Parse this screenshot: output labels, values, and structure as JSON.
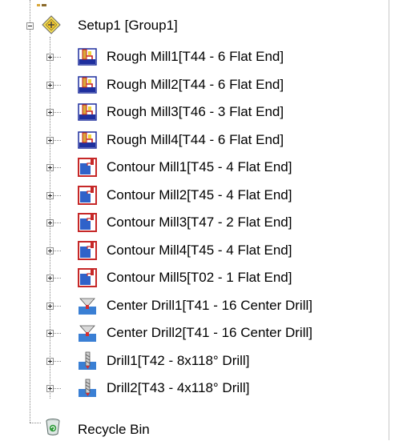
{
  "tree": {
    "setup": {
      "label": "Setup1 [Group1]",
      "expanded": true,
      "icon": "setup-diamond-icon"
    },
    "operations": [
      {
        "label": "Rough Mill1[T44 - 6 Flat End]",
        "icon": "rough-mill-icon"
      },
      {
        "label": "Rough Mill2[T44 - 6 Flat End]",
        "icon": "rough-mill-icon"
      },
      {
        "label": "Rough Mill3[T46 - 3 Flat End]",
        "icon": "rough-mill-icon"
      },
      {
        "label": "Rough Mill4[T44 - 6 Flat End]",
        "icon": "rough-mill-icon"
      },
      {
        "label": "Contour Mill1[T45 - 4 Flat End]",
        "icon": "contour-mill-icon"
      },
      {
        "label": "Contour Mill2[T45 - 4 Flat End]",
        "icon": "contour-mill-icon"
      },
      {
        "label": "Contour Mill3[T47 - 2 Flat End]",
        "icon": "contour-mill-icon"
      },
      {
        "label": "Contour Mill4[T45 - 4 Flat End]",
        "icon": "contour-mill-icon"
      },
      {
        "label": "Contour Mill5[T02 - 1 Flat End]",
        "icon": "contour-mill-icon"
      },
      {
        "label": "Center Drill1[T41 - 16 Center Drill]",
        "icon": "center-drill-icon"
      },
      {
        "label": "Center Drill2[T41 - 16 Center Drill]",
        "icon": "center-drill-icon"
      },
      {
        "label": "Drill1[T42 - 8x118° Drill]",
        "icon": "drill-icon"
      },
      {
        "label": "Drill2[T43 - 4x118° Drill]",
        "icon": "drill-icon"
      }
    ],
    "recycle_bin": {
      "label": "Recycle Bin",
      "icon": "recycle-bin-icon"
    }
  },
  "colors": {
    "rough_mill_accent": "#c81e1e",
    "rough_mill_bg": "#1e2f9e",
    "contour_border": "#c62828",
    "contour_fill": "#2f62c9",
    "drill_blue": "#3a7fd4",
    "drill_red": "#d32f2f",
    "setup_yellow": "#f2d43b"
  }
}
